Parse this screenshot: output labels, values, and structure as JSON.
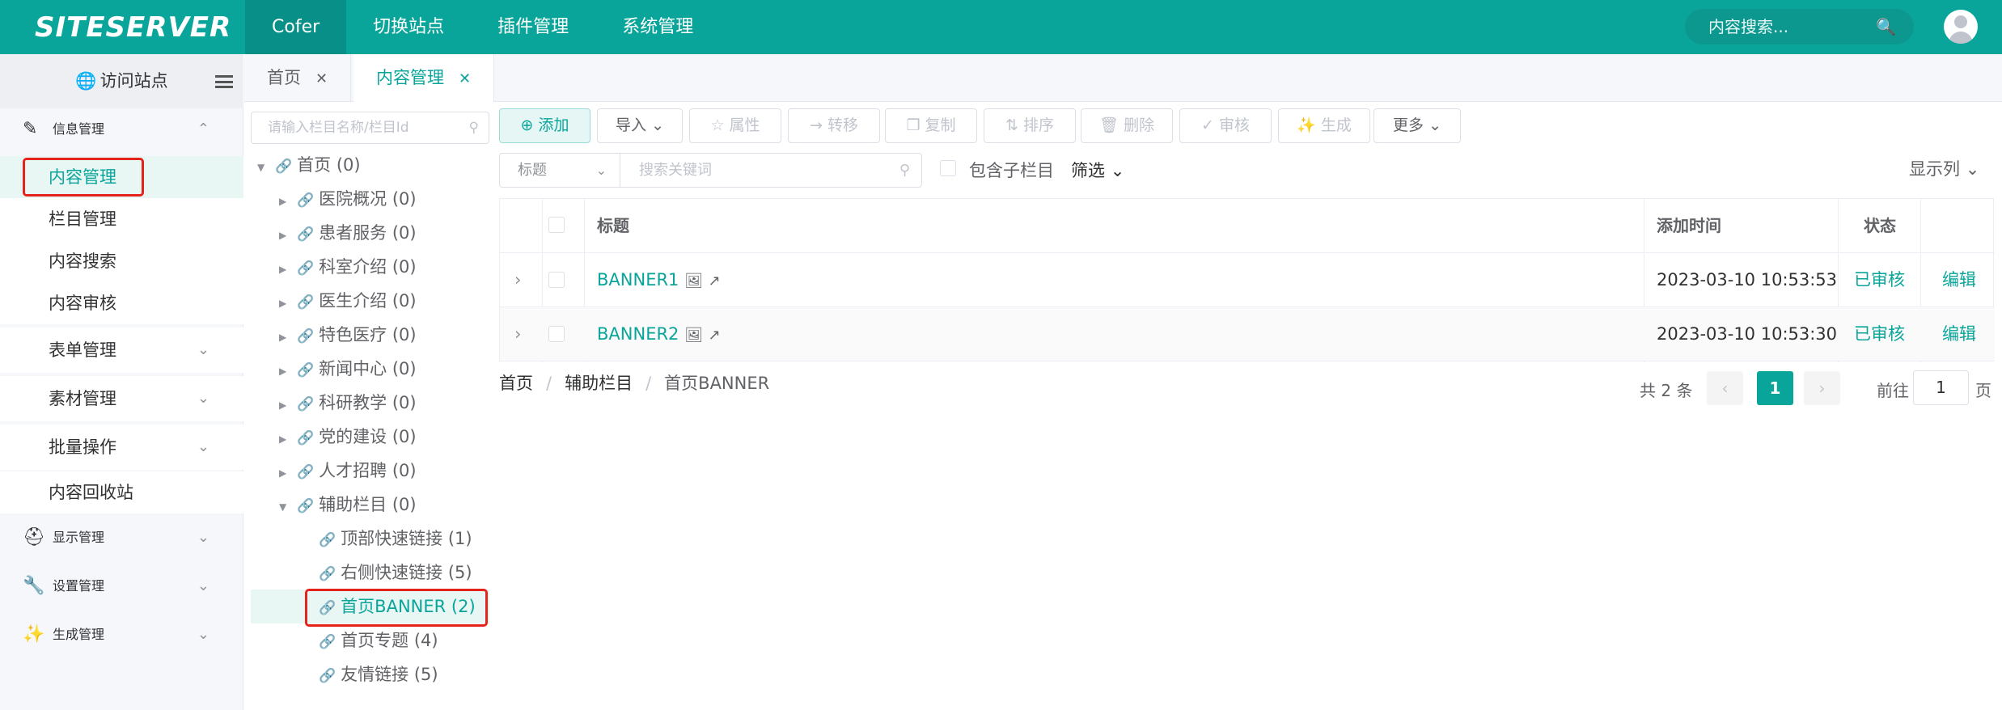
{
  "topbar": {
    "logo": "SITESERVER",
    "nav": [
      "Cofer",
      "切换站点",
      "插件管理",
      "系统管理"
    ],
    "search_placeholder": "内容搜索..."
  },
  "sidebar": {
    "visit": "访问站点",
    "groups": {
      "info": "信息管理",
      "display": "显示管理",
      "settings": "设置管理",
      "generate": "生成管理"
    },
    "items": [
      "内容管理",
      "栏目管理",
      "内容搜索",
      "内容审核",
      "表单管理",
      "素材管理",
      "批量操作",
      "内容回收站"
    ]
  },
  "tabs": [
    "首页",
    "内容管理"
  ],
  "tree": {
    "search_placeholder": "请输入栏目名称/栏目Id",
    "root": "首页 (0)",
    "children": [
      "医院概况 (0)",
      "患者服务 (0)",
      "科室介绍 (0)",
      "医生介绍 (0)",
      "特色医疗 (0)",
      "新闻中心 (0)",
      "科研教学 (0)",
      "党的建设 (0)",
      "人才招聘 (0)",
      "辅助栏目 (0)"
    ],
    "sub_children": [
      "顶部快速链接 (1)",
      "右侧快速链接 (5)",
      "首页BANNER (2)",
      "首页专题 (4)",
      "友情链接 (5)"
    ]
  },
  "toolbar": {
    "add": "添加",
    "import": "导入",
    "attr": "属性",
    "move": "转移",
    "copy": "复制",
    "sort": "排序",
    "delete": "删除",
    "audit": "审核",
    "generate": "生成",
    "more": "更多"
  },
  "filter": {
    "field": "标题",
    "keyword_placeholder": "搜索关键词",
    "include_children": "包含子栏目",
    "filter_label": "筛选",
    "columns_label": "显示列"
  },
  "table": {
    "headers": {
      "title": "标题",
      "added": "添加时间",
      "status": "状态"
    },
    "rows": [
      {
        "title": "BANNER1",
        "added": "2023-03-10 10:53:53",
        "status": "已审核",
        "action": "编辑"
      },
      {
        "title": "BANNER2",
        "added": "2023-03-10 10:53:30",
        "status": "已审核",
        "action": "编辑"
      }
    ]
  },
  "breadcrumb": [
    "首页",
    "辅助栏目",
    "首页BANNER"
  ],
  "pager": {
    "total": "共 2 条",
    "current": "1",
    "goto_prefix": "前往",
    "goto_value": "1",
    "goto_suffix": "页"
  },
  "colors": {
    "accent": "#0aa59a",
    "highlight": "#e5231b"
  }
}
